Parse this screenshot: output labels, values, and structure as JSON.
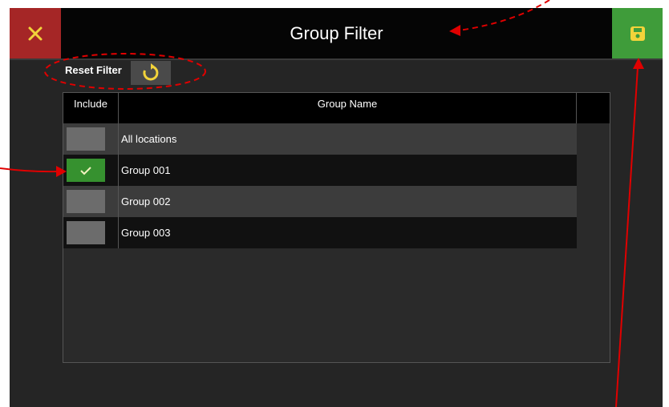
{
  "header": {
    "title": "Group Filter",
    "close_icon": "close-icon",
    "save_icon": "floppy-disk-icon"
  },
  "toolbar": {
    "reset_label": "Reset Filter",
    "reset_icon": "refresh-icon"
  },
  "table": {
    "columns": [
      "Include",
      "Group Name"
    ],
    "rows": [
      {
        "name": "All locations",
        "included": false
      },
      {
        "name": "Group 001",
        "included": true
      },
      {
        "name": "Group 002",
        "included": false
      },
      {
        "name": "Group 003",
        "included": false
      }
    ]
  },
  "colors": {
    "close": "#a52626",
    "save": "#3f9c3a",
    "checked": "#36912f",
    "annotation": "#e00000",
    "accent_icon": "#f2d33a"
  }
}
